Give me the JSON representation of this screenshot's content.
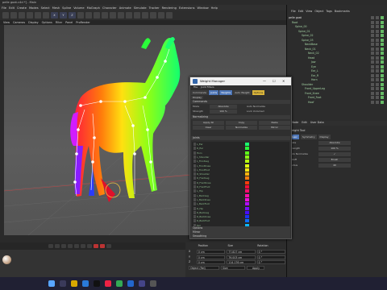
{
  "window": {
    "title": "pelle goat.c4d *] - Main"
  },
  "menubar": [
    "File",
    "Edit",
    "Create",
    "Modes",
    "Select",
    "Mesh",
    "Spline",
    "Volume",
    "MoGraph",
    "Character",
    "Animate",
    "Simulate",
    "Tracker",
    "Rendering",
    "Extensions",
    "Window",
    "Help"
  ],
  "toolbar": {
    "axis_labels": [
      "X",
      "Y",
      "Z"
    ]
  },
  "viewport_menu": [
    "View",
    "Cameras",
    "Display",
    "Options",
    "Filter",
    "Panel",
    "ProRender"
  ],
  "object_manager": {
    "tabs": [
      "File",
      "Edit",
      "View",
      "Object",
      "Tags",
      "Bookmarks"
    ],
    "items": [
      {
        "label": "pelle goat",
        "depth": 0
      },
      {
        "label": "Root",
        "depth": 1
      },
      {
        "label": "Spine_00",
        "depth": 2
      },
      {
        "label": "Spine_01",
        "depth": 3
      },
      {
        "label": "Spine_02",
        "depth": 4
      },
      {
        "label": "Spine_03",
        "depth": 4
      },
      {
        "label": "NeckBase",
        "depth": 5
      },
      {
        "label": "Neck_01",
        "depth": 5
      },
      {
        "label": "Neck_02",
        "depth": 6
      },
      {
        "label": "Head",
        "depth": 6
      },
      {
        "label": "Jaw",
        "depth": 7
      },
      {
        "label": "Eye",
        "depth": 7
      },
      {
        "label": "Ear_L",
        "depth": 7
      },
      {
        "label": "Ear_R",
        "depth": 7
      },
      {
        "label": "Horn",
        "depth": 7
      },
      {
        "label": "Shoulder",
        "depth": 4
      },
      {
        "label": "Front_UpperLeg",
        "depth": 5
      },
      {
        "label": "Front_Knee",
        "depth": 5
      },
      {
        "label": "Front_Foot",
        "depth": 6
      },
      {
        "label": "Hoof",
        "depth": 6
      }
    ]
  },
  "attributes": {
    "tabs": [
      "Mode",
      "Edit",
      "User Data"
    ],
    "header": "Weight Tool",
    "subtabs": [
      "Basic",
      "Symmetry",
      "Display"
    ],
    "rows": [
      {
        "label": "Mode",
        "value": "Absolute"
      },
      {
        "label": "Strength",
        "value": "100 %"
      },
      {
        "label": "Auto Normalize",
        "value": "✓"
      },
      {
        "label": "Falloff",
        "value": "Brush"
      },
      {
        "label": "Radius",
        "value": "40"
      }
    ]
  },
  "weight_manager": {
    "title": "Weight Manager",
    "controls": [
      "—",
      "☐",
      "✕"
    ],
    "menu": [
      "File",
      "Joint Filters"
    ],
    "tabs": [
      "Commands",
      "Joints",
      "Weights",
      "Auto Weight",
      "Options"
    ],
    "display_tab": "Display",
    "sections": {
      "commands": "Commands",
      "normalizing": "Normalizing",
      "joints": "Joints",
      "options": "Options",
      "mirror": "Mirror",
      "smoothing": "Smoothing"
    },
    "mode_label": "Mode",
    "mode_value": "Absolute",
    "strength_label": "Strength",
    "strength_value": "100 %",
    "auto_normalize": "Auto Normalize",
    "lock_unlocked": "Lock Unlocked",
    "buttons": [
      "Apply All",
      "Copy",
      "Paste",
      "Clear",
      "Normalize",
      "Mirror"
    ],
    "buttons2": [
      "Set Weight",
      "Copy",
      "Paste",
      "Clear",
      "Smooth",
      "Bleed",
      "Normalize",
      "Mirror → Y",
      "Fill"
    ],
    "joints_list": [
      "L_Ear",
      "R_Ear",
      "Horn",
      "L_Shoulder",
      "L_FrontLeg",
      "L_FrontKnee",
      "L_FrontFoot",
      "R_Shoulder",
      "R_FrontLeg",
      "R_FrontKnee",
      "R_FrontFoot",
      "L_Hip",
      "L_BackLeg",
      "L_BackKnee",
      "L_BackFoot",
      "R_Hip",
      "R_BackLeg",
      "R_BackKnee",
      "R_BackFoot",
      "Tail"
    ],
    "joints_colors": [
      "#1aff6e",
      "#2aff3a",
      "#5fff1a",
      "#8dff16",
      "#b7ff12",
      "#e0ff10",
      "#ffe60f",
      "#ffb30e",
      "#ff7e0d",
      "#ff3c0c",
      "#ff0c36",
      "#ff0c6d",
      "#ff0ca7",
      "#f10cdd",
      "#b20cff",
      "#7a0cff",
      "#470cff",
      "#1a2fff",
      "#0c6dff",
      "#0cb7ff"
    ]
  },
  "coords": {
    "headers": [
      "Position",
      "Size",
      "Rotation"
    ],
    "rows": [
      {
        "axis": "X",
        "pos": "0 cm",
        "size": "77.827 cm",
        "rot": "0 °"
      },
      {
        "axis": "Y",
        "pos": "0 cm",
        "size": "79.003 cm",
        "rot": "0 °"
      },
      {
        "axis": "Z",
        "pos": "0 cm",
        "size": "114.176 cm",
        "rot": "0 °"
      }
    ],
    "object_mode": "Object (Rel)",
    "size_mode": "Size",
    "apply": "Apply"
  },
  "timeline": {
    "frame_start": "0 F",
    "frame_end": "90 F"
  },
  "colors": {
    "accent": "#4f77b8",
    "selected_tab": "#d9b43a"
  }
}
